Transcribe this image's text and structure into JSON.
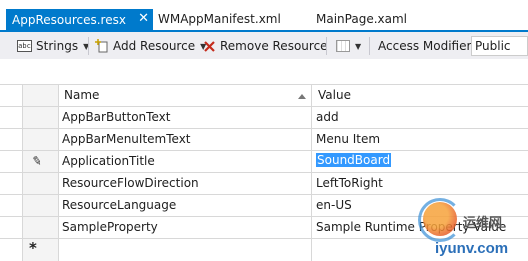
{
  "tabs": {
    "active": {
      "label": "AppResources.resx",
      "close": "✕"
    },
    "others": [
      {
        "label": "WMAppManifest.xml"
      },
      {
        "label": "MainPage.xaml"
      }
    ]
  },
  "toolbar": {
    "strings_label": "Strings",
    "add_resource_label": "Add Resource",
    "remove_resource_label": "Remove Resource",
    "access_modifier_label": "Access Modifier:",
    "access_modifier_value": "Public",
    "abc_icon_text": "abc"
  },
  "grid": {
    "columns": {
      "name": "Name",
      "value": "Value"
    },
    "rows": [
      {
        "name": "AppBarButtonText",
        "value": "add"
      },
      {
        "name": "AppBarMenuItemText",
        "value": "Menu Item"
      },
      {
        "name": "ApplicationTitle",
        "value": "SoundBoard",
        "editing": true
      },
      {
        "name": "ResourceFlowDirection",
        "value": "LeftToRight"
      },
      {
        "name": "ResourceLanguage",
        "value": "en-US"
      },
      {
        "name": "SampleProperty",
        "value": "Sample Runtime Property Value"
      }
    ],
    "new_row_marker": "*"
  },
  "watermark": {
    "cn": "运维网",
    "url": "iyunv.com"
  },
  "colors": {
    "accent": "#007acc",
    "selection": "#3399ff",
    "toolbar_bg": "#eeeef2",
    "remove_icon": "#c42b1c"
  }
}
